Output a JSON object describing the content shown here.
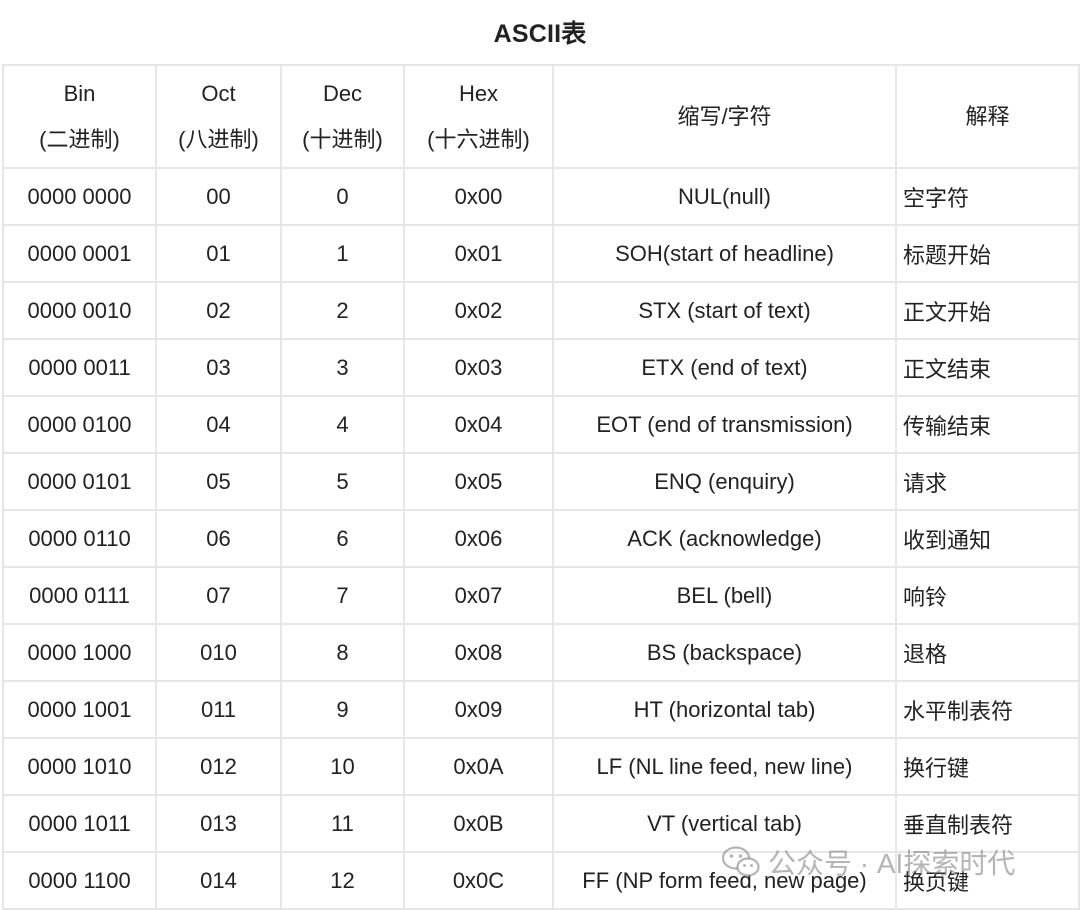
{
  "title": "ASCII表",
  "columns": [
    {
      "line1": "Bin",
      "line2": "(二进制)"
    },
    {
      "line1": "Oct",
      "line2": "(八进制)"
    },
    {
      "line1": "Dec",
      "line2": "(十进制)"
    },
    {
      "line1": "Hex",
      "line2": "(十六进制)"
    },
    {
      "line1": "缩写/字符",
      "line2": ""
    },
    {
      "line1": "解释",
      "line2": ""
    }
  ],
  "rows": [
    {
      "bin": "0000 0000",
      "oct": "00",
      "dec": "0",
      "hex": "0x00",
      "abbr": "NUL(null)",
      "desc": "空字符"
    },
    {
      "bin": "0000 0001",
      "oct": "01",
      "dec": "1",
      "hex": "0x01",
      "abbr": "SOH(start of headline)",
      "desc": "标题开始"
    },
    {
      "bin": "0000 0010",
      "oct": "02",
      "dec": "2",
      "hex": "0x02",
      "abbr": "STX (start of text)",
      "desc": "正文开始"
    },
    {
      "bin": "0000 0011",
      "oct": "03",
      "dec": "3",
      "hex": "0x03",
      "abbr": "ETX (end of text)",
      "desc": "正文结束"
    },
    {
      "bin": "0000 0100",
      "oct": "04",
      "dec": "4",
      "hex": "0x04",
      "abbr": "EOT (end of transmission)",
      "desc": "传输结束"
    },
    {
      "bin": "0000 0101",
      "oct": "05",
      "dec": "5",
      "hex": "0x05",
      "abbr": "ENQ (enquiry)",
      "desc": "请求"
    },
    {
      "bin": "0000 0110",
      "oct": "06",
      "dec": "6",
      "hex": "0x06",
      "abbr": "ACK (acknowledge)",
      "desc": "收到通知"
    },
    {
      "bin": "0000 0111",
      "oct": "07",
      "dec": "7",
      "hex": "0x07",
      "abbr": "BEL (bell)",
      "desc": "响铃"
    },
    {
      "bin": "0000 1000",
      "oct": "010",
      "dec": "8",
      "hex": "0x08",
      "abbr": "BS (backspace)",
      "desc": "退格"
    },
    {
      "bin": "0000 1001",
      "oct": "011",
      "dec": "9",
      "hex": "0x09",
      "abbr": "HT (horizontal tab)",
      "desc": "水平制表符"
    },
    {
      "bin": "0000 1010",
      "oct": "012",
      "dec": "10",
      "hex": "0x0A",
      "abbr": "LF (NL line feed, new line)",
      "desc": "换行键"
    },
    {
      "bin": "0000 1011",
      "oct": "013",
      "dec": "11",
      "hex": "0x0B",
      "abbr": "VT (vertical tab)",
      "desc": "垂直制表符"
    },
    {
      "bin": "0000 1100",
      "oct": "014",
      "dec": "12",
      "hex": "0x0C",
      "abbr": "FF (NP form feed, new page)",
      "desc": "换页键"
    }
  ],
  "watermark": {
    "text": "公众号 · AI探索时代",
    "icon": "wechat-icon"
  }
}
